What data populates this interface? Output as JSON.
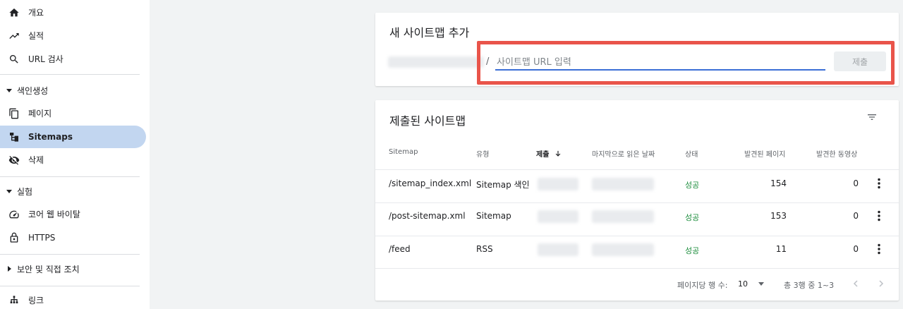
{
  "sidebar": {
    "items": [
      {
        "label": "개요",
        "icon": "home-icon"
      },
      {
        "label": "실적",
        "icon": "trending-up-icon"
      },
      {
        "label": "URL 검사",
        "icon": "search-icon"
      }
    ],
    "index_section": {
      "label": "색인생성",
      "items": [
        {
          "label": "페이지",
          "icon": "pages-icon"
        },
        {
          "label": "Sitemaps",
          "icon": "sitemap-icon",
          "active": true
        },
        {
          "label": "삭제",
          "icon": "visibility-off-icon"
        }
      ]
    },
    "experience_section": {
      "label": "실험",
      "items": [
        {
          "label": "코어 웹 바이탈",
          "icon": "speed-icon"
        },
        {
          "label": "HTTPS",
          "icon": "lock-icon"
        }
      ]
    },
    "security_section": {
      "label": "보안 및 직접 조치"
    },
    "links_item": {
      "label": "링크",
      "icon": "links-icon"
    }
  },
  "add_sitemap": {
    "title": "새 사이트맵 추가",
    "prefix": "/",
    "input_placeholder": "사이트맵 URL 입력",
    "input_value": "",
    "submit_label": "제출"
  },
  "submitted": {
    "title": "제출된 사이트맵",
    "columns": {
      "sitemap": "Sitemap",
      "type": "유형",
      "submitted": "제출",
      "last_read": "마지막으로 읽은 날짜",
      "status": "상태",
      "pages_found": "발견된 페이지",
      "videos_found": "발견한 동영상"
    },
    "rows": [
      {
        "sitemap": "/sitemap_index.xml",
        "type": "Sitemap 색인",
        "status": "성공",
        "pages": "154",
        "videos": "0"
      },
      {
        "sitemap": "/post-sitemap.xml",
        "type": "Sitemap",
        "status": "성공",
        "pages": "153",
        "videos": "0"
      },
      {
        "sitemap": "/feed",
        "type": "RSS",
        "status": "성공",
        "pages": "11",
        "videos": "0"
      }
    ],
    "footer": {
      "rows_per_page_label": "페이지당 행 수:",
      "rows_per_page": "10",
      "range": "총 3행 중 1~3"
    }
  },
  "colors": {
    "accent": "#3c6fd6",
    "active_nav": "#c2d6f0",
    "highlight_border": "#e9544a",
    "success": "#1e8e3e"
  }
}
